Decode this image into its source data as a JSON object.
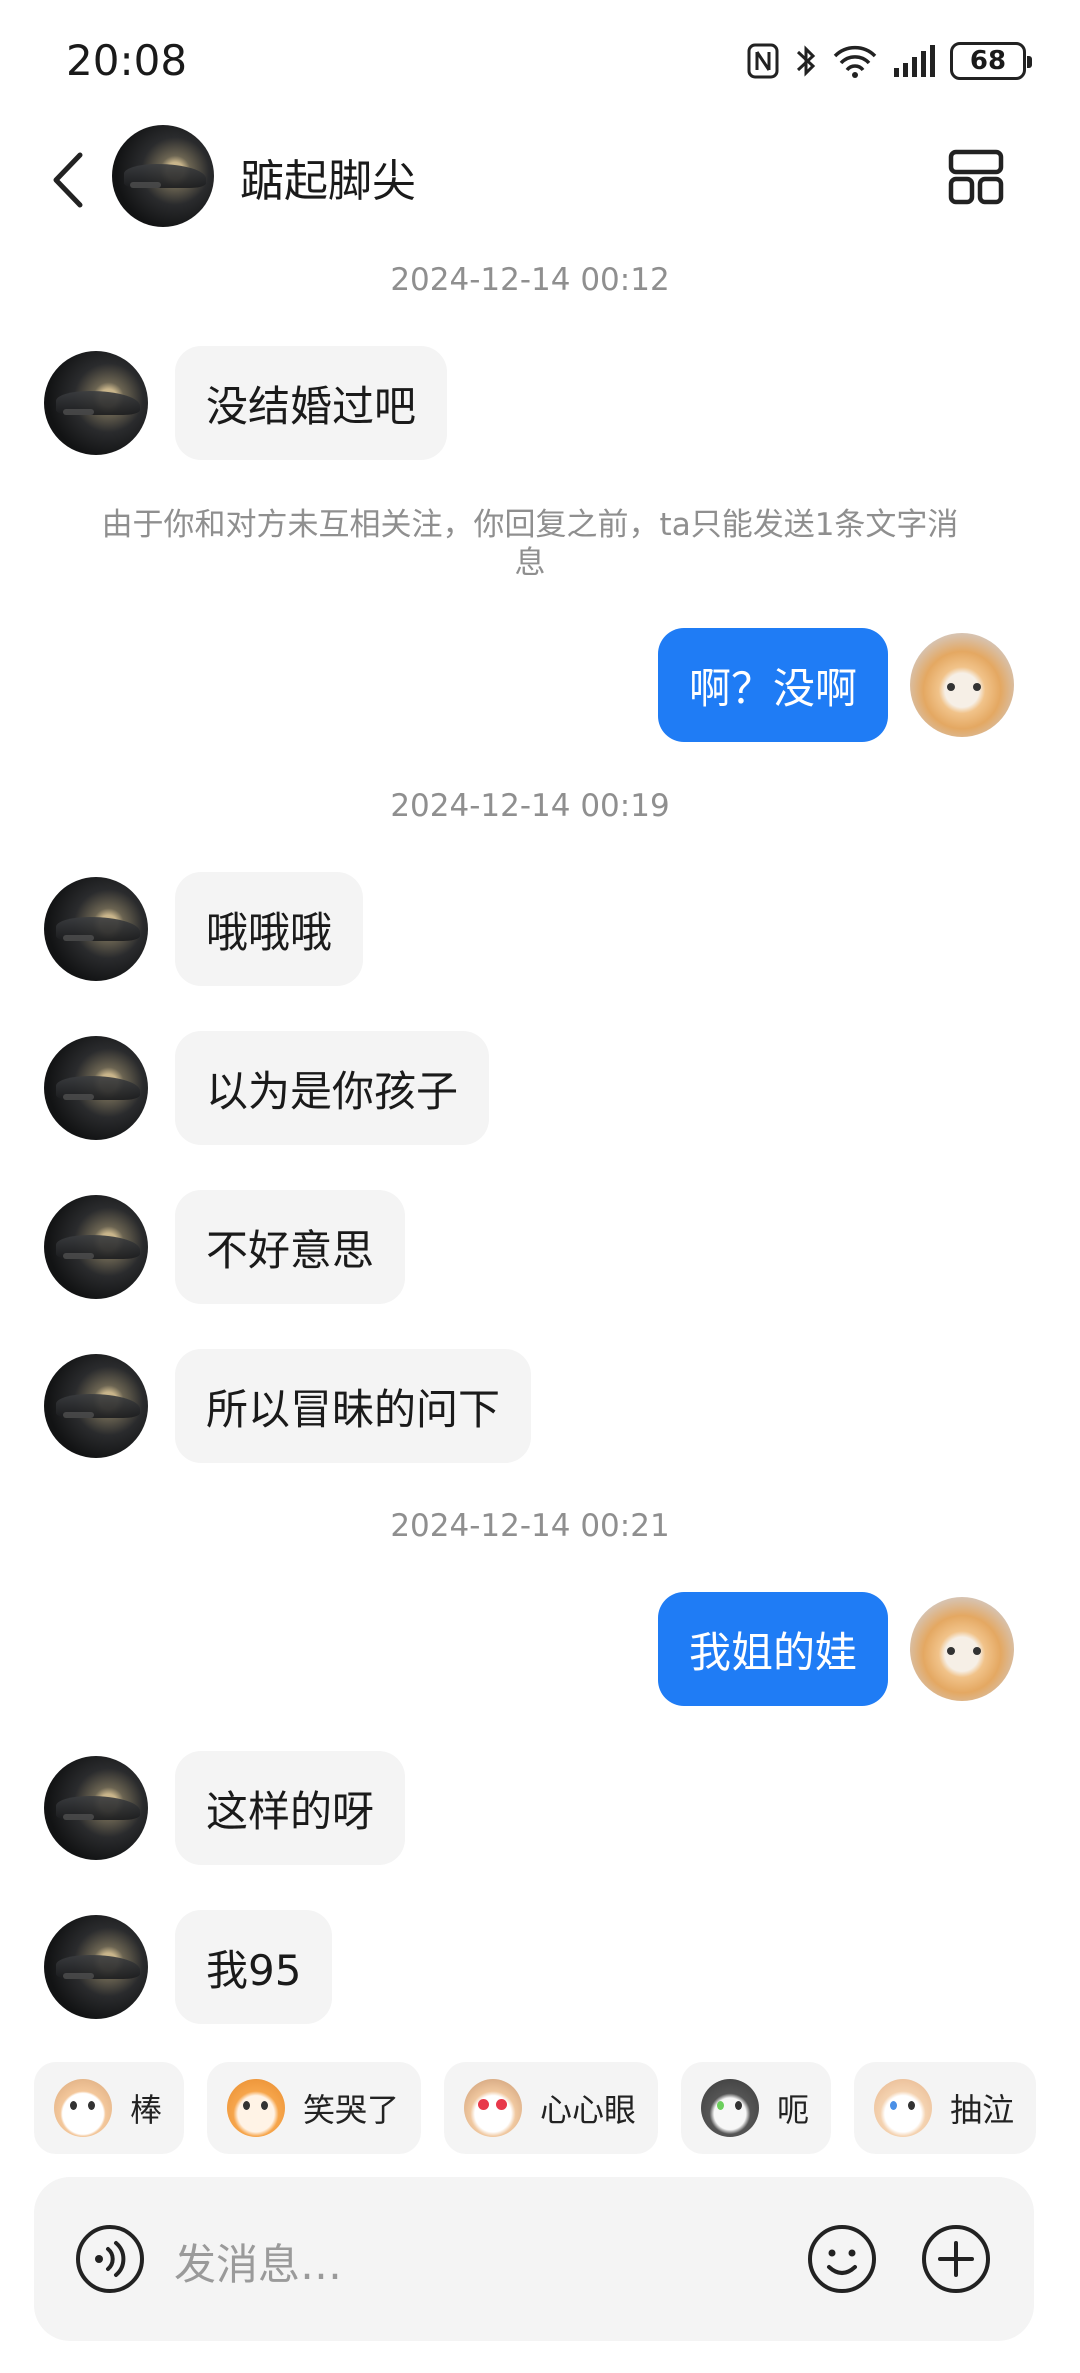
{
  "status_bar": {
    "time": "20:08",
    "battery": "68"
  },
  "header": {
    "contact_name": "踮起脚尖"
  },
  "conversation": {
    "timestamps": [
      "2024-12-14 00:12",
      "2024-12-14 00:19",
      "2024-12-14 00:21"
    ],
    "system_notice": "由于你和对方未互相关注，你回复之前，ta只能发送1条文字消息",
    "messages": [
      {
        "side": "left",
        "text": "没结婚过吧"
      },
      {
        "side": "right",
        "text": "啊？没啊"
      },
      {
        "side": "left",
        "text": "哦哦哦"
      },
      {
        "side": "left",
        "text": "以为是你孩子"
      },
      {
        "side": "left",
        "text": "不好意思"
      },
      {
        "side": "left",
        "text": "所以冒昧的问下"
      },
      {
        "side": "right",
        "text": "我姐的娃"
      },
      {
        "side": "left",
        "text": "这样的呀"
      },
      {
        "side": "left",
        "text": "我95"
      }
    ]
  },
  "quick_emojis": [
    {
      "label": "棒",
      "icon": "cat-thumbs-up-emoji"
    },
    {
      "label": "笑哭了",
      "icon": "cat-laugh-cry-emoji"
    },
    {
      "label": "心心眼",
      "icon": "cat-heart-eyes-emoji"
    },
    {
      "label": "呃",
      "icon": "cat-awkward-emoji"
    },
    {
      "label": "抽泣",
      "icon": "cat-sob-emoji"
    }
  ],
  "input": {
    "placeholder": "发消息…"
  },
  "colors": {
    "sent_bubble": "#1f7cf5",
    "received_bubble": "#f4f4f4",
    "muted_text": "#8f8f8f"
  }
}
